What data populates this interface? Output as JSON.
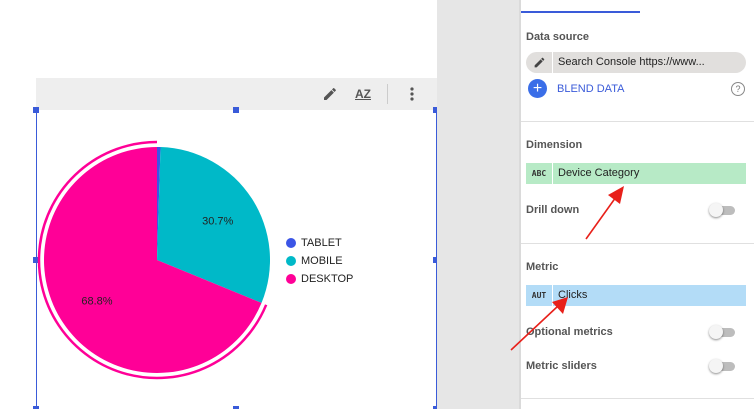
{
  "toolbar": {
    "icons": [
      "pencil-icon",
      "sort-az-icon",
      "more-vert-icon"
    ],
    "sort_label": "AZ"
  },
  "chart_data": {
    "type": "pie",
    "categories": [
      "TABLET",
      "MOBILE",
      "DESKTOP"
    ],
    "values": [
      0.5,
      30.7,
      68.8
    ],
    "unit": "%",
    "colors": [
      "#3b55e6",
      "#00b9c8",
      "#ff0097"
    ],
    "labels": [
      "",
      "30.7%",
      "68.8%"
    ],
    "legend_position": "right",
    "highlighted_slice": "DESKTOP"
  },
  "panel": {
    "data_source": {
      "title": "Data source",
      "value": "Search Console https://www...",
      "blend_label": "BLEND DATA",
      "help_icon": "?"
    },
    "dimension": {
      "title": "Dimension",
      "type_badge": "ABC",
      "field": "Device Category",
      "chip_color": "#b7eac6",
      "drill_down_label": "Drill down"
    },
    "metric": {
      "title": "Metric",
      "type_badge": "AUT",
      "field": "Clicks",
      "chip_color": "#b3dcf7",
      "optional_metrics_label": "Optional metrics",
      "metric_sliders_label": "Metric sliders"
    }
  },
  "annotations": {
    "arrow_color": "#e8201a"
  }
}
